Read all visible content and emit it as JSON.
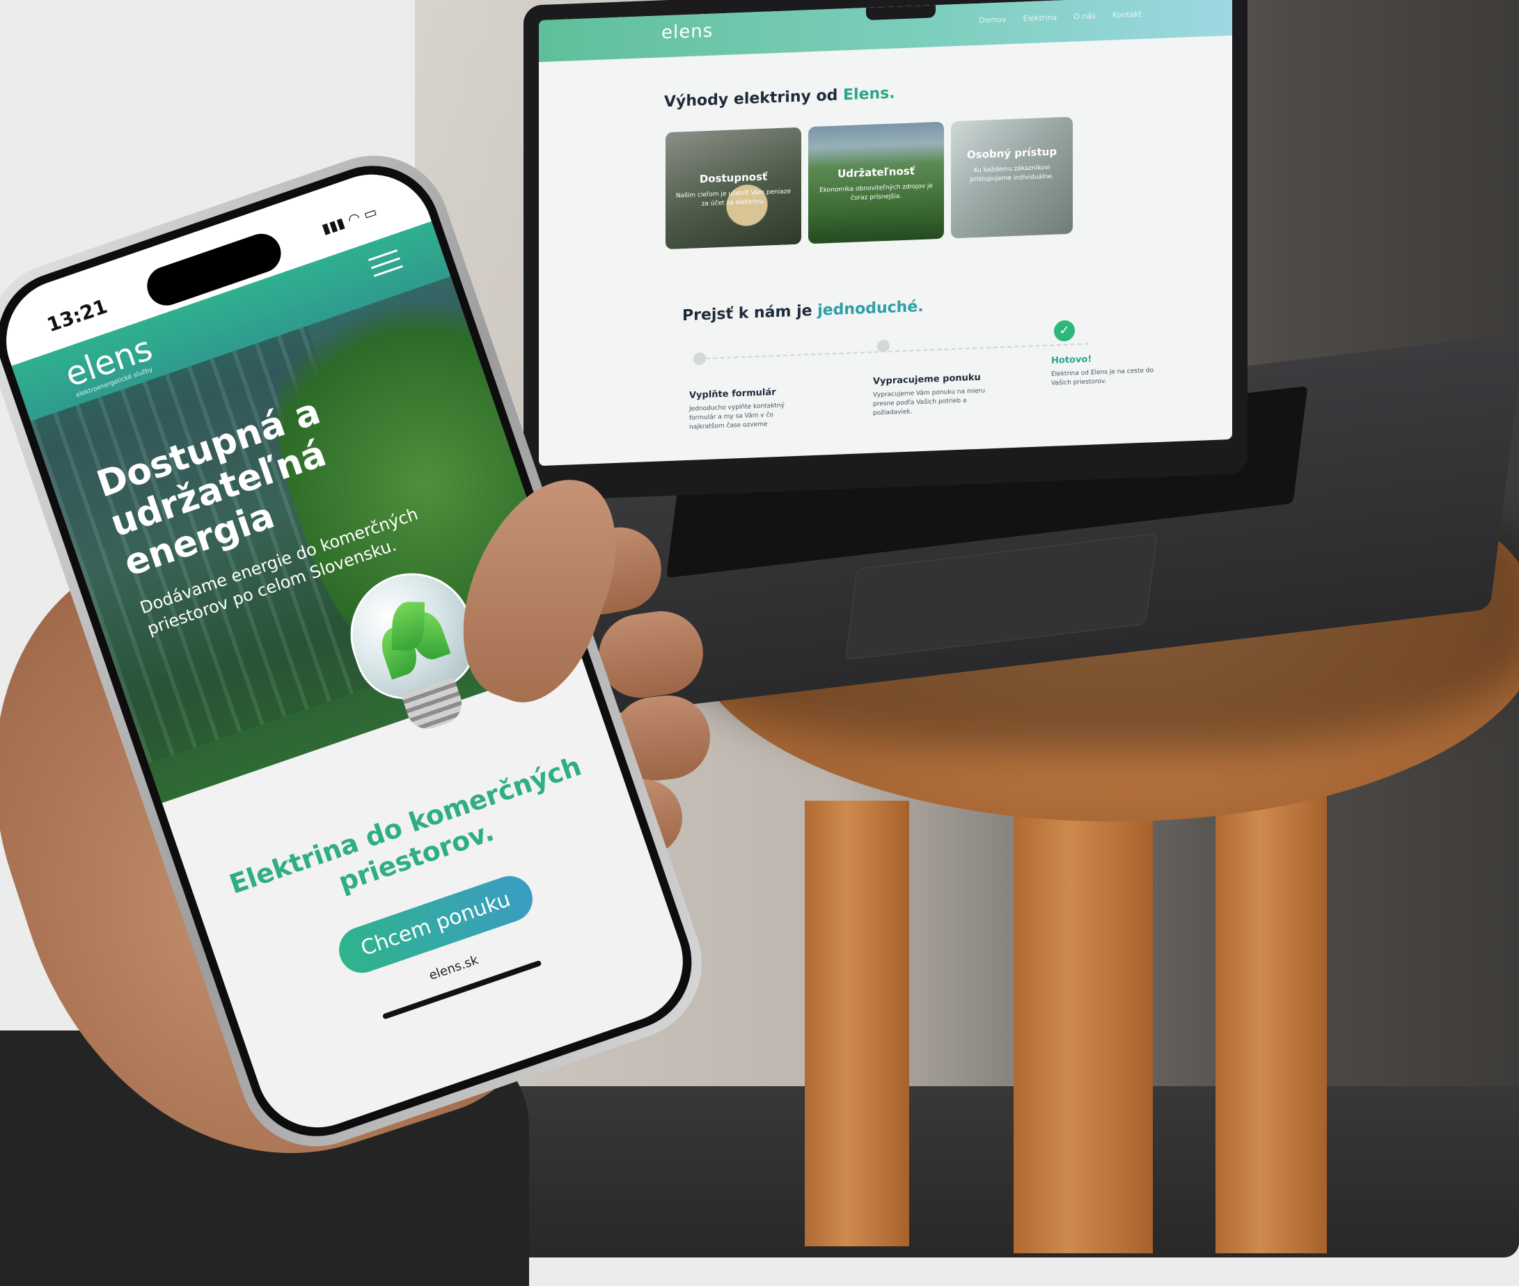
{
  "laptop_site": {
    "logo": "elens",
    "nav": [
      "Domov",
      "Elektrina",
      "O nás",
      "Kontakt"
    ],
    "benefits_heading_prefix": "Výhody elektriny od ",
    "benefits_heading_brand": "Elens.",
    "cards": [
      {
        "title": "Dostupnosť",
        "desc": "Našim cieľom je ušetriť Vám peniaze za účet za elektrinu."
      },
      {
        "title": "Udržateľnosť",
        "desc": "Ekonomika obnoviteľných zdrojov je čoraz prísnejšia."
      },
      {
        "title": "Osobný prístup",
        "desc": "Ku každému zákazníkovi pristupujeme individuálne."
      }
    ],
    "switch_heading_prefix": "Prejsť k nám je ",
    "switch_heading_accent": "jednoduché.",
    "steps": [
      {
        "title": "Vyplňte formulár",
        "desc": "Jednoducho vyplňte kontaktný formulár a my sa Vám v čo najkratšom čase ozveme"
      },
      {
        "title": "Vypracujeme ponuku",
        "desc": "Vypracujeme Vám ponuku na mieru presne podľa Vašich potrieb a požiadaviek."
      },
      {
        "title": "Hotovo!",
        "desc": "Elektrina od Elens je na ceste do Vašich priestorov."
      }
    ],
    "cta": "Chcem ponuku"
  },
  "phone_site": {
    "time": "13:21",
    "logo": "elens",
    "logo_sub": "elektroenergetické služby",
    "hero_title": "Dostupná a udržateľná energia",
    "hero_subtitle": "Dodávame energie do komerčných priestorov po celom Slovensku.",
    "section_title": "Elektrina do komerčných priestorov.",
    "cta": "Chcem ponuku",
    "url": "elens.sk"
  },
  "colors": {
    "brand_green": "#2eae82",
    "brand_teal": "#3a9cc4",
    "wood": "#b8743e"
  }
}
